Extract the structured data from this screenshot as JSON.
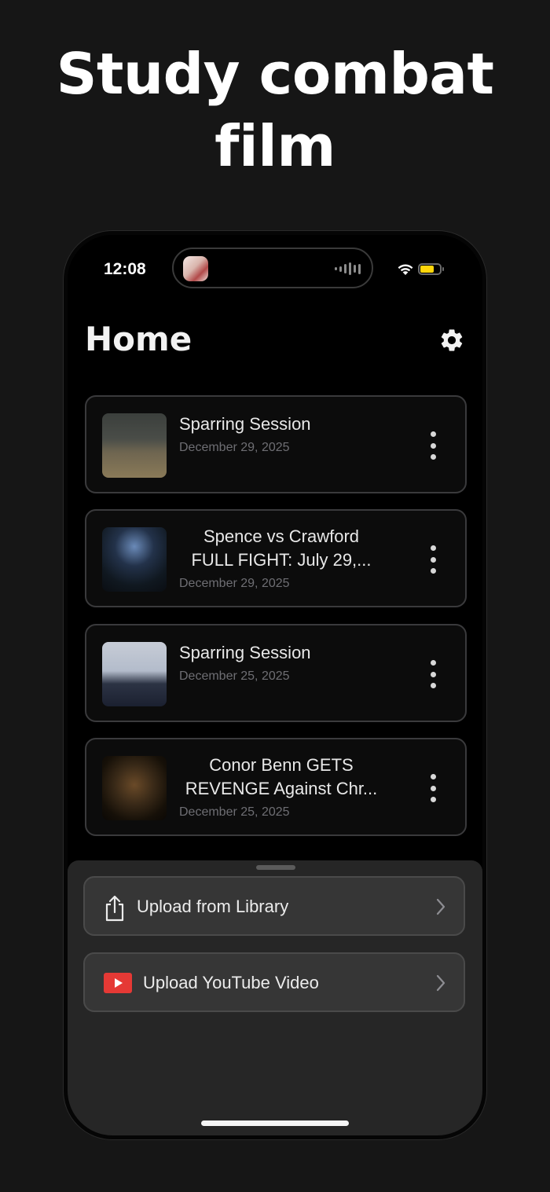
{
  "promo": {
    "line1": "Study combat",
    "line2": "film"
  },
  "status_bar": {
    "time": "12:08",
    "battery_color": "#ffd60a"
  },
  "header": {
    "title": "Home"
  },
  "videos": [
    {
      "title_line1": "Sparring Session",
      "title_line2": "",
      "date": "December 29, 2025"
    },
    {
      "title_line1": "Spence vs Crawford",
      "title_line2": "FULL FIGHT: July 29,...",
      "date": "December 29, 2025"
    },
    {
      "title_line1": "Sparring Session",
      "title_line2": "",
      "date": "December 25, 2025"
    },
    {
      "title_line1": "Conor Benn GETS",
      "title_line2": "REVENGE Against Chr...",
      "date": "December 25, 2025"
    }
  ],
  "upload_sheet": {
    "library_label": "Upload from Library",
    "youtube_label": "Upload YouTube Video",
    "youtube_color": "#e53935"
  }
}
